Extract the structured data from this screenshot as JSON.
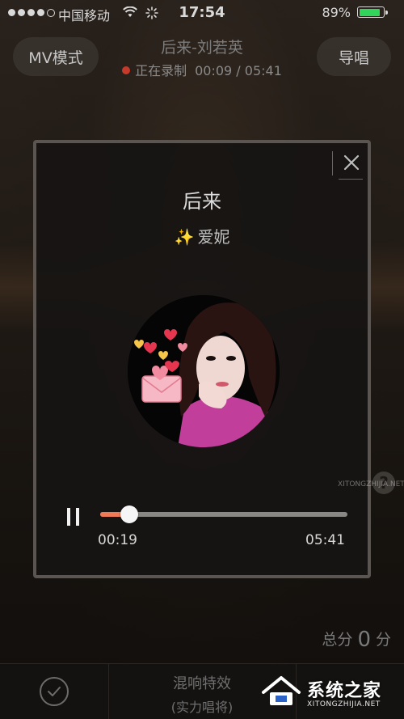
{
  "status_bar": {
    "carrier": "中国移动",
    "time": "17:54",
    "battery_percent": "89%",
    "battery_level": 0.89,
    "signal_bars": 4,
    "signal_total": 5
  },
  "header": {
    "mv_button_label": "MV模式",
    "song_title": "后来-刘若英",
    "recording_label": "正在录制",
    "recording_time": "00:09 / 05:41",
    "guide_button_label": "导唱"
  },
  "player": {
    "title": "后来",
    "artist": "爱妮",
    "artist_icon": "sparkle-icon",
    "elapsed": "00:19",
    "total": "05:41",
    "progress": 0.117,
    "close_icon": "close-icon",
    "pause_icon": "pause-icon"
  },
  "help": {
    "label": "?"
  },
  "score": {
    "prefix": "总分",
    "value": "0",
    "suffix": "分"
  },
  "bottom_bar": {
    "confirm_icon": "checkmark-icon",
    "effects_label": "混响特效",
    "effects_sub": "(实力唱将)"
  },
  "watermark": {
    "text": "系统之家",
    "url": "XITONGZHIJIA.NET",
    "side": "XITONGZHIJIA.NET"
  },
  "colors": {
    "accent": "#f07a56",
    "battery": "#33d45a",
    "recording_dot": "#c63a2b",
    "sparkle": "#f3cc45"
  }
}
